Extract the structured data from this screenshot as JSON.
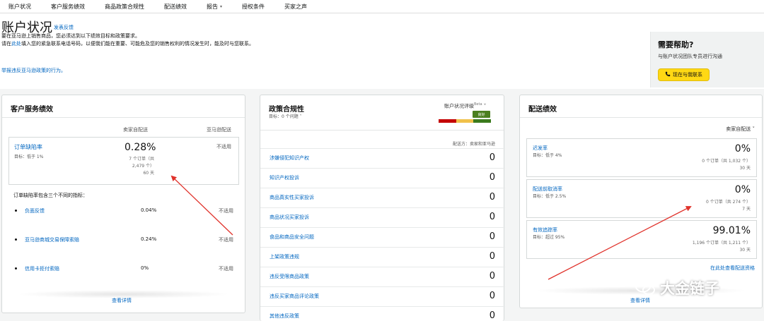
{
  "nav": {
    "items": [
      "账户状况",
      "客户服务绩效",
      "商品政策合规性",
      "配送绩效",
      "报告",
      "授权条件",
      "买家之声"
    ]
  },
  "header": {
    "title": "账户状况",
    "feedback_link": "发表反馈",
    "intro_line1": "要在亚马逊上销售商品，您必须达到以下绩效目标和政策要求。",
    "intro_line2_pre": "请在",
    "intro_line2_link": "此处",
    "intro_line2_post": "填入您的紧急联系电话号码，以便我们能在重要、可能危及您的销售权利的情况发生时，能及时与您联系。",
    "report_link": "举报违反亚马逊政策的行为。"
  },
  "help": {
    "title": "需要帮助?",
    "subtitle": "与账户状况团队专员进行沟通",
    "button": "现在与我联系"
  },
  "customer_service": {
    "title": "客户服务绩效",
    "col_seller": "卖家自配送",
    "col_amazon": "亚马逊配送",
    "odr": {
      "name": "订单缺陷率",
      "target": "目标：低于 1%",
      "value": "0.28%",
      "orders_line1": "7 个订单（共",
      "orders_line2": "2,479 个）",
      "days": "60 天",
      "amazon_value": "不适用"
    },
    "sub_heading": "订单缺陷率包含三个不同的指标：",
    "sub_metrics": [
      {
        "label": "负面反馈",
        "value": "0.04%",
        "amazon": "不适用"
      },
      {
        "label": "亚马逊商城交易保障索赔",
        "value": "0.24%",
        "amazon": "不适用"
      },
      {
        "label": "信用卡拒付索赔",
        "value": "0%",
        "amazon": "不适用"
      }
    ],
    "details_link": "查看详情"
  },
  "policy": {
    "title": "政策合规性",
    "target": "目标：0 个问题",
    "health_label": "账户状况评级",
    "beta": "Beta",
    "health_badge": "良好",
    "fulfilled_by": "配送方：卖家和亚马逊",
    "rows": [
      {
        "label": "涉嫌侵犯知识产权",
        "value": "0"
      },
      {
        "label": "知识产权投诉",
        "value": "0"
      },
      {
        "label": "商品真实性买家投诉",
        "value": "0"
      },
      {
        "label": "商品状况买家投诉",
        "value": "0"
      },
      {
        "label": "食品和商品安全问题",
        "value": "0"
      },
      {
        "label": "上架政策违规",
        "value": "0"
      },
      {
        "label": "违反受限商品政策",
        "value": "0"
      },
      {
        "label": "违反买家商品评论政策",
        "value": "0"
      },
      {
        "label": "其他违反政策",
        "value": "0"
      }
    ]
  },
  "shipping": {
    "title": "配送绩效",
    "fulfilled_by": "卖家自配送",
    "metrics": [
      {
        "name": "迟发率",
        "target": "目标：低于 4%",
        "value": "0%",
        "orders": "0 个订单（共 1,032 个）",
        "days": "30 天"
      },
      {
        "name": "配送前取消率",
        "target": "目标：低于 2.5%",
        "value": "0%",
        "orders": "0 个订单（共 274 个）",
        "days": "7 天"
      },
      {
        "name": "有效追踪率",
        "target": "目标：超过 95%",
        "value": "99.01%",
        "orders": "1,196 个订单（共 1,211 个）",
        "days": "30 天"
      }
    ],
    "view_link": "在此处查看配送资格",
    "details_link": "查看详情"
  },
  "watermark": "大金链子",
  "colors": {
    "link": "#0066c0",
    "arrow": "#e0322b",
    "help_button": "#ffd814",
    "health_good": "#4b7f1f"
  }
}
